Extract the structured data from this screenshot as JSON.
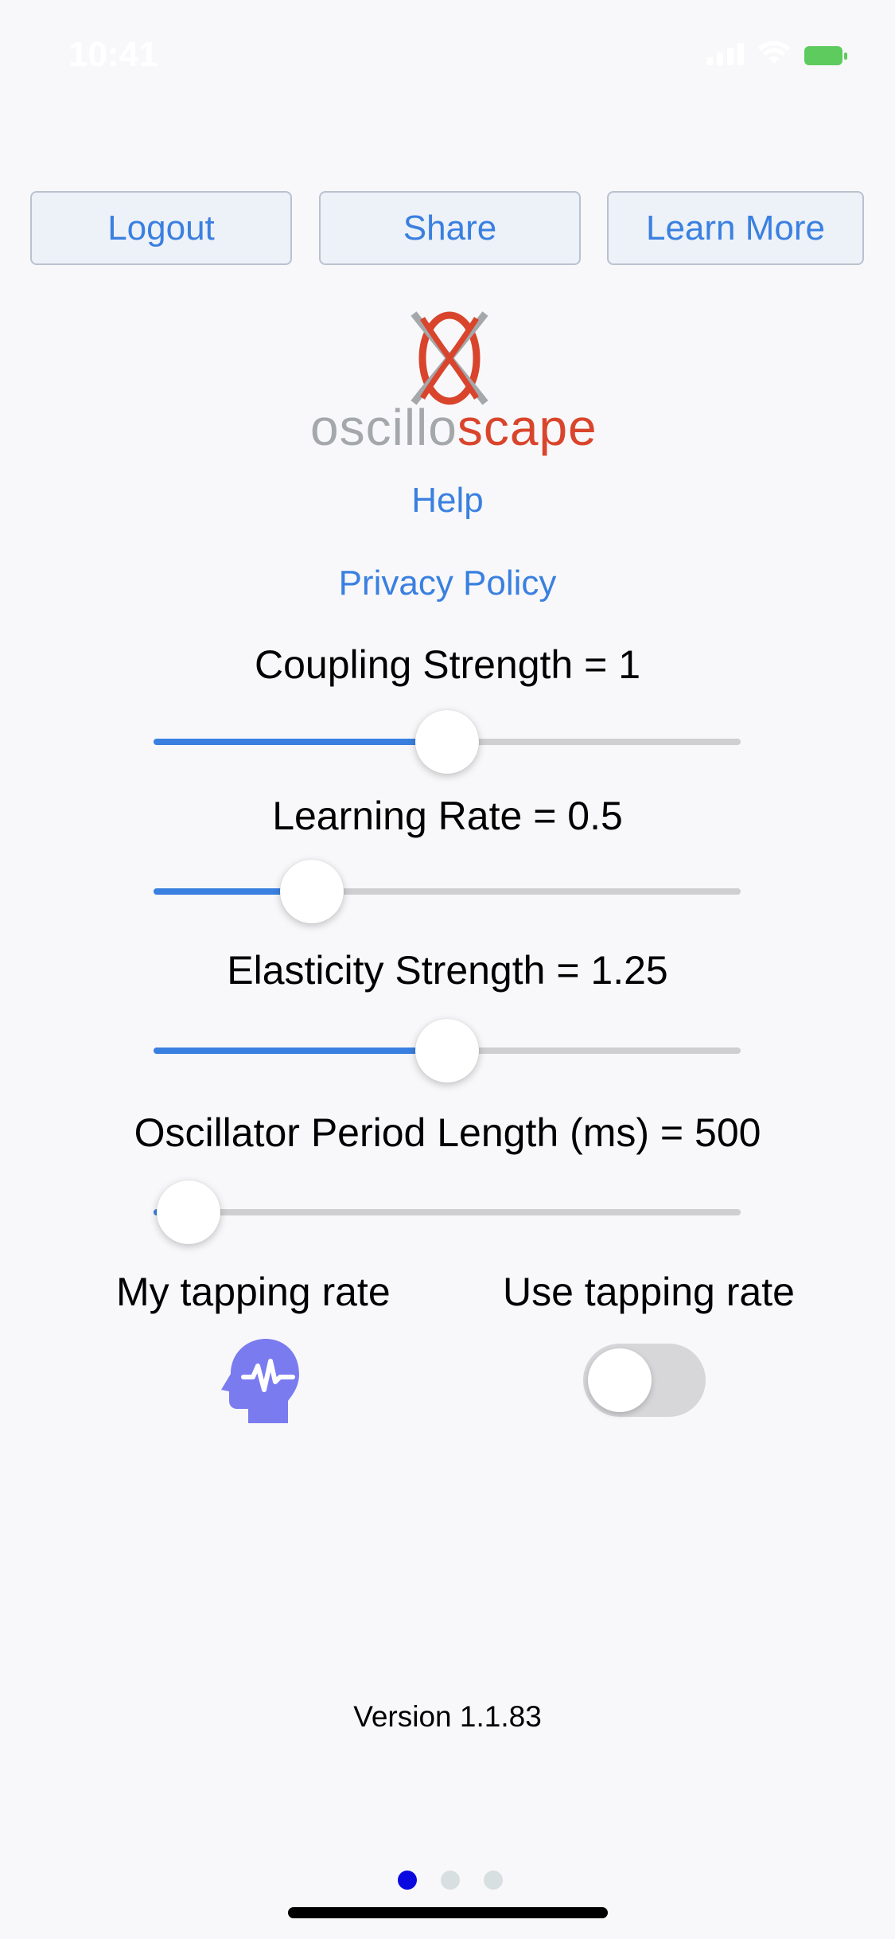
{
  "status_bar": {
    "time": "10:41"
  },
  "toolbar": {
    "logout_label": "Logout",
    "share_label": "Share",
    "learn_more_label": "Learn More"
  },
  "logo": {
    "word_left": "oscillo",
    "word_right": "scape"
  },
  "links": {
    "help": "Help",
    "privacy": "Privacy Policy"
  },
  "settings": {
    "coupling": {
      "label": "Coupling Strength = 1",
      "fraction": 0.5
    },
    "learning": {
      "label": "Learning Rate = 0.5",
      "fraction": 0.27
    },
    "elasticity": {
      "label": "Elasticity Strength = 1.25",
      "fraction": 0.5
    },
    "period": {
      "label": "Oscillator Period Length (ms) = 500",
      "fraction": 0.06
    }
  },
  "tapping": {
    "my_rate_label": "My tapping rate",
    "use_rate_label": "Use tapping rate",
    "use_rate_on": false
  },
  "version": "Version  1.1.83",
  "pager": {
    "count": 3,
    "active": 0
  },
  "colors": {
    "accent": "#3a80e0",
    "logo_red": "#d9452c",
    "logo_gray": "#a5a8ab",
    "brain_icon": "#7b7bf0",
    "page_dot_active": "#0a0ae0"
  }
}
